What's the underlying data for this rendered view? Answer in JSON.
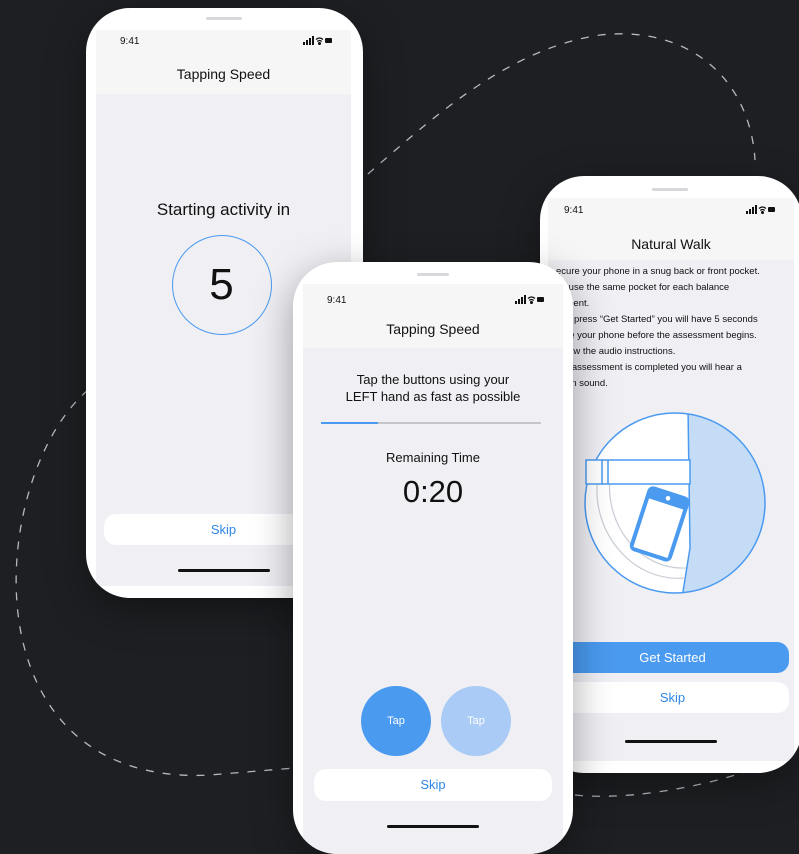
{
  "colors": {
    "background": "#1d1f22",
    "accent": "#4a9af0",
    "accent_light": "#a9cbf5",
    "link_blue": "#2f86e6",
    "decor_line": "#d0d4da"
  },
  "status_bar": {
    "time": "9:41",
    "icons": [
      "signal-icon",
      "wifi-icon",
      "battery-icon"
    ]
  },
  "countdown_screen": {
    "title": "Tapping Speed",
    "starting_text": "Starting activity in",
    "countdown_value": "5",
    "skip_label": "Skip"
  },
  "tapping_screen": {
    "title": "Tapping Speed",
    "instruction_line1": "Tap the buttons using your",
    "instruction_line2": "LEFT hand as fast as possible",
    "progress": 0.26,
    "remaining_label": "Remaining Time",
    "remaining_value": "0:20",
    "tap_left_label": "Tap",
    "tap_right_label": "Tap",
    "skip_label": "Skip"
  },
  "walk_screen": {
    "title": "Natural Walk",
    "instructions": [
      "ecure your phone in a snug back or front pocket.",
      "se use the same pocket for each balance",
      "ssment.",
      "you press “Get Started” you will have 5 seconds",
      "cure your phone before the assessment begins.",
      "follow the audio instructions.",
      "the assessment is completed you will hear a",
      "ation sound."
    ],
    "illustration": "phone-in-pocket-illustration",
    "get_started_label": "Get Started",
    "skip_label": "Skip"
  }
}
